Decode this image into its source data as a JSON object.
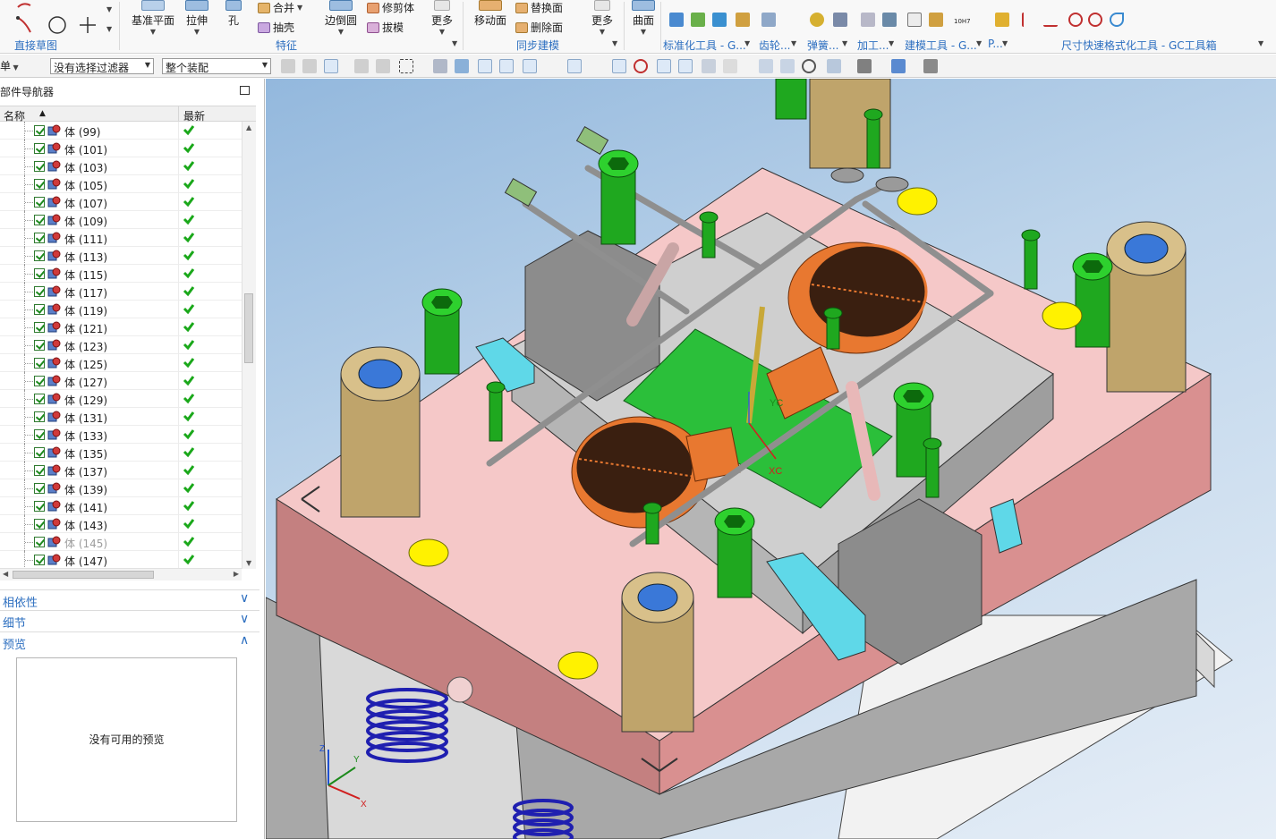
{
  "ribbon": {
    "groups": {
      "sketch": "直接草图",
      "feature": "特征",
      "sync": "同步建模",
      "standard": "标准化工具 - G...",
      "gear": "齿轮...",
      "spring": "弹簧...",
      "machining": "加工...",
      "modeling": "建模工具 - G...",
      "p": "P...",
      "dimension": "尺寸快速格式化工具 - GC工具箱"
    },
    "buttons": {
      "datum_plane": "基准平面",
      "extrude": "拉伸",
      "hole": "孔",
      "unite": "合并",
      "shell": "抽壳",
      "edge_blend": "边倒圆",
      "trim_body": "修剪体",
      "draft": "拔模",
      "more1": "更多",
      "move_face": "移动面",
      "replace_face": "替换面",
      "delete_face": "删除面",
      "more2": "更多",
      "surface": "曲面"
    },
    "labels": {
      "tolerance_badge": "10H7"
    }
  },
  "toolbar2": {
    "menu_label": "单",
    "filter_value": "没有选择过滤器",
    "scope_value": "整个装配"
  },
  "navigator": {
    "title": "部件导航器",
    "col_name": "名称",
    "col_latest": "最新",
    "items": [
      {
        "label": "体 (99)",
        "dim": false
      },
      {
        "label": "体 (101)",
        "dim": false
      },
      {
        "label": "体 (103)",
        "dim": false
      },
      {
        "label": "体 (105)",
        "dim": false
      },
      {
        "label": "体 (107)",
        "dim": false
      },
      {
        "label": "体 (109)",
        "dim": false
      },
      {
        "label": "体 (111)",
        "dim": false
      },
      {
        "label": "体 (113)",
        "dim": false
      },
      {
        "label": "体 (115)",
        "dim": false
      },
      {
        "label": "体 (117)",
        "dim": false
      },
      {
        "label": "体 (119)",
        "dim": false
      },
      {
        "label": "体 (121)",
        "dim": false
      },
      {
        "label": "体 (123)",
        "dim": false
      },
      {
        "label": "体 (125)",
        "dim": false
      },
      {
        "label": "体 (127)",
        "dim": false
      },
      {
        "label": "体 (129)",
        "dim": false
      },
      {
        "label": "体 (131)",
        "dim": false
      },
      {
        "label": "体 (133)",
        "dim": false
      },
      {
        "label": "体 (135)",
        "dim": false
      },
      {
        "label": "体 (137)",
        "dim": false
      },
      {
        "label": "体 (139)",
        "dim": false
      },
      {
        "label": "体 (141)",
        "dim": false
      },
      {
        "label": "体 (143)",
        "dim": false
      },
      {
        "label": "体 (145)",
        "dim": true
      },
      {
        "label": "体 (147)",
        "dim": false
      }
    ],
    "panels": {
      "dependencies": "相依性",
      "details": "细节",
      "preview": "预览",
      "no_preview": "没有可用的预览"
    }
  },
  "viewport": {
    "axis_xc": "XC",
    "axis_yc": "YC",
    "triad_x": "X",
    "triad_y": "Y",
    "triad_z": "Z"
  },
  "colors": {
    "accent_blue": "#2d6fc0",
    "plate_pink": "#f3c2c2",
    "plate_side": "#cf8686",
    "steel_gray": "#bdbdbd",
    "bolt_green": "#1fb31f",
    "part_orange": "#e87830",
    "pillar_tan": "#bfa46b",
    "marker_yellow": "#fff200",
    "status_check": "#1aa81a"
  }
}
